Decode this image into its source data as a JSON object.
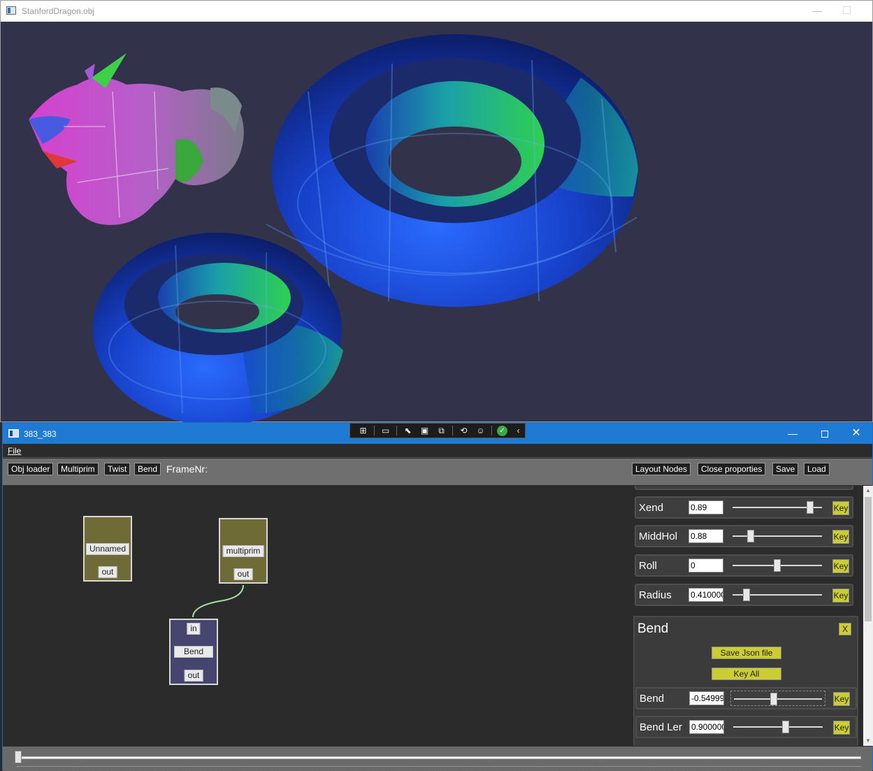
{
  "viewer": {
    "title": "StanfordDragon.obj",
    "minimize_glyph": "—"
  },
  "editor": {
    "title": "383_383",
    "minimize_glyph": "—",
    "close_glyph": "✕",
    "menu": {
      "file": "File"
    },
    "toolbar": {
      "obj_loader": "Obj loader",
      "multiprim": "Multiprim",
      "twist": "Twist",
      "bend": "Bend",
      "frame_label": "FrameNr:",
      "layout_nodes": "Layout Nodes",
      "close_properties": "Close proporties",
      "save": "Save",
      "load": "Load"
    },
    "nodes": {
      "unnamed": {
        "label": "Unnamed",
        "out": "out"
      },
      "multiprim": {
        "label": "multiprim",
        "out": "out"
      },
      "bend": {
        "in": "in",
        "label": "Bend",
        "out": "out"
      }
    },
    "properties": {
      "rows": [
        {
          "name": "Xend",
          "value": "0.89",
          "slider_fraction": 0.89,
          "key": "Key"
        },
        {
          "name": "MiddHol",
          "value": "0.88",
          "slider_fraction": 0.18,
          "key": "Key"
        },
        {
          "name": "Roll",
          "value": "0",
          "slider_fraction": 0.5,
          "key": "Key"
        },
        {
          "name": "Radius",
          "value": "0.410000",
          "slider_fraction": 0.13,
          "key": "Key"
        }
      ],
      "bend_panel": {
        "title": "Bend",
        "close": "X",
        "save_json": "Save Json file",
        "key_all": "Key All",
        "rows": [
          {
            "name": "Bend",
            "value": "-0.54999",
            "slider_fraction": 0.45,
            "key": "Key"
          },
          {
            "name": "Bend Ler",
            "value": "0.900000",
            "slider_fraction": 0.59,
            "key": "Key"
          }
        ]
      }
    },
    "timeline": {
      "frame_fraction": 0.0
    }
  },
  "scene_colors": {
    "background": "#32324a",
    "torus_blue": "#1a4fd8",
    "torus_teal": "#1fa8a0",
    "torus_green": "#2ec44a",
    "dragon_magenta": "#d23ad6"
  }
}
